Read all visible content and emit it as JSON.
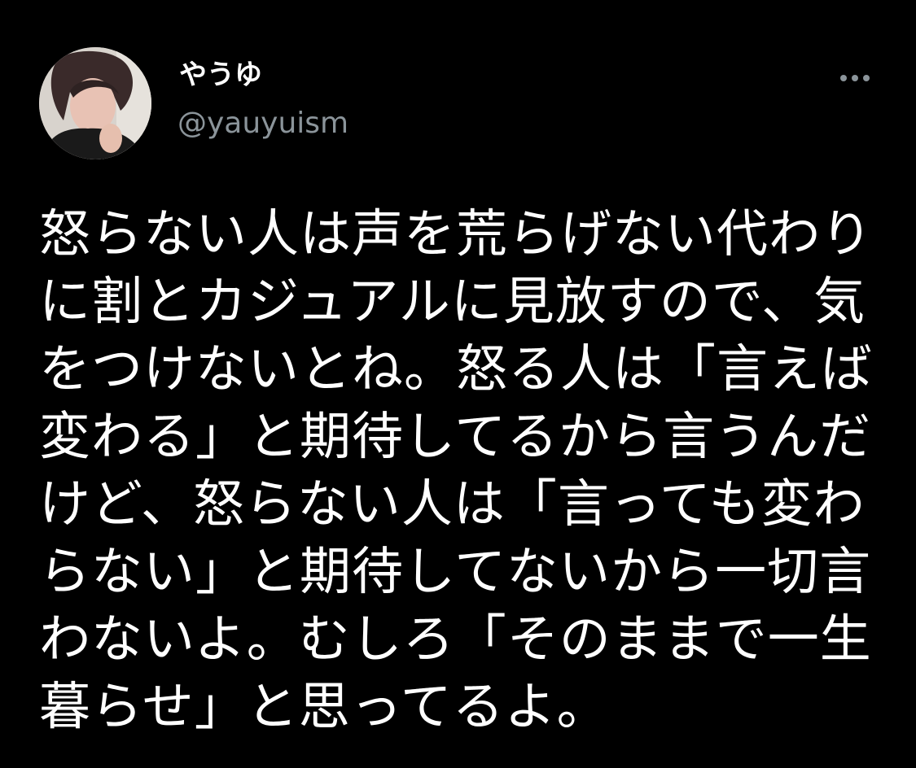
{
  "author": {
    "display_name": "やうゆ",
    "handle": "@yauyuism",
    "avatar_icon": "profile-photo"
  },
  "more_icon": "ellipsis-icon",
  "tweet": {
    "lines": [
      "怒らない人は声を荒らげない代わり",
      "に割とカジュアルに見放すので、気",
      "をつけないとね。怒る人は「言えば",
      "変わる」と期待してるから言うんだ",
      "けど、怒らない人は「言っても変わ",
      "らない」と期待してないから一切言",
      "わないよ。むしろ「そのままで一生",
      "暮らせ」と思ってるよ。"
    ]
  },
  "colors": {
    "background": "#000000",
    "text": "#ffffff",
    "secondary": "#8b949a"
  }
}
